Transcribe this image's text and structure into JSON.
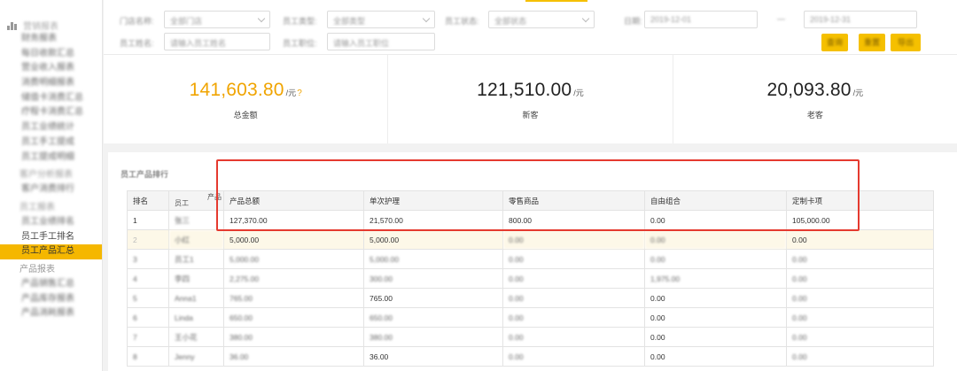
{
  "sidebar": {
    "header": "营销报表",
    "items": [
      {
        "label": "财务报表",
        "blurred": true,
        "group": false
      },
      {
        "label": "每日收款汇总",
        "blurred": true,
        "group": false
      },
      {
        "label": "营业收入报表",
        "blurred": true,
        "group": false
      },
      {
        "label": "消费明细报表",
        "blurred": true,
        "group": false
      },
      {
        "label": "储值卡消费汇总",
        "blurred": true,
        "group": false
      },
      {
        "label": "疗程卡消费汇总",
        "blurred": true,
        "group": false
      },
      {
        "label": "员工业绩统计",
        "blurred": true,
        "group": false
      },
      {
        "label": "员工手工提成",
        "blurred": true,
        "group": false
      },
      {
        "label": "员工提成明细",
        "blurred": true,
        "group": false
      },
      {
        "label": "客户分析报表",
        "blurred": true,
        "group": true
      },
      {
        "label": "客户消费排行",
        "blurred": true,
        "group": false
      },
      {
        "label": "员工报表",
        "blurred": true,
        "group": true
      },
      {
        "label": "员工业绩排名",
        "blurred": true,
        "group": false
      },
      {
        "label": "员工手工排名",
        "blurred": false,
        "group": false
      },
      {
        "label": "员工产品汇总",
        "blurred": false,
        "group": false,
        "active": true
      },
      {
        "label": "产品报表",
        "blurred": false,
        "group": true
      },
      {
        "label": "产品销售汇总",
        "blurred": true,
        "group": false
      },
      {
        "label": "产品库存报表",
        "blurred": true,
        "group": false
      },
      {
        "label": "产品消耗报表",
        "blurred": true,
        "group": false
      }
    ]
  },
  "filters": {
    "store_label": "门店名称:",
    "store_value": "全部门店",
    "type_label": "员工类型:",
    "type_value": "全部类型",
    "status_label": "员工状态:",
    "status_value": "全部状态",
    "date_label": "日期:",
    "date_value": "2019-12-01",
    "date_end": "2019-12-31",
    "sep": "—",
    "name_label": "员工姓名:",
    "name_placeholder": "请输入员工姓名",
    "job_label": "员工职位:",
    "job_placeholder": "请输入员工职位",
    "btn_search": "查询",
    "btn_reset": "重置",
    "btn_export": "导出"
  },
  "summary": [
    {
      "value": "141,603.80",
      "unit": "/元",
      "extra": "?",
      "label": "总金额",
      "highlight": true
    },
    {
      "value": "121,510.00",
      "unit": "/元",
      "extra": "",
      "label": "新客",
      "highlight": false
    },
    {
      "value": "20,093.80",
      "unit": "/元",
      "extra": "",
      "label": "老客",
      "highlight": false
    }
  ],
  "table": {
    "title": "员工产品排行",
    "corner_top": "产品",
    "corner_bottom": "员工",
    "headers": [
      "排名",
      "员工",
      "产品总额",
      "单次护理",
      "零售商品",
      "自由组合",
      "定制卡项"
    ],
    "rows": [
      {
        "rank": "1",
        "name": "张三",
        "total": "127,370.00",
        "care": "21,570.00",
        "retail": "800.00",
        "combo": "0.00",
        "custom": "105,000.00",
        "blur": "name"
      },
      {
        "rank": "2",
        "name": "小红",
        "total": "5,000.00",
        "care": "5,000.00",
        "retail": "0.00",
        "combo": "0.00",
        "custom": "0.00",
        "blur": "row-hl"
      },
      {
        "rank": "3",
        "name": "员工1",
        "total": "5,000.00",
        "care": "5,000.00",
        "retail": "0.00",
        "combo": "0.00",
        "custom": "0.00",
        "blur": "all"
      },
      {
        "rank": "4",
        "name": "李四",
        "total": "2,275.00",
        "care": "300.00",
        "retail": "0.00",
        "combo": "1,975.00",
        "custom": "0.00",
        "blur": "all"
      },
      {
        "rank": "5",
        "name": "Anna1",
        "total": "765.00",
        "care": "765.00",
        "retail": "0.00",
        "combo": "0.00",
        "custom": "0.00",
        "blur": "mixed5"
      },
      {
        "rank": "6",
        "name": "Linda",
        "total": "650.00",
        "care": "650.00",
        "retail": "0.00",
        "combo": "0.00",
        "custom": "0.00",
        "blur": "mixed"
      },
      {
        "rank": "7",
        "name": "王小花",
        "total": "380.00",
        "care": "380.00",
        "retail": "0.00",
        "combo": "0.00",
        "custom": "0.00",
        "blur": "mixed"
      },
      {
        "rank": "8",
        "name": "Jenny",
        "total": "36.00",
        "care": "36.00",
        "retail": "0.00",
        "combo": "0.00",
        "custom": "0.00",
        "blur": "mixed8"
      }
    ]
  },
  "colors": {
    "accent": "#f5c000",
    "highlight_number": "#f0a400",
    "annotation_box": "#e53a2f"
  }
}
